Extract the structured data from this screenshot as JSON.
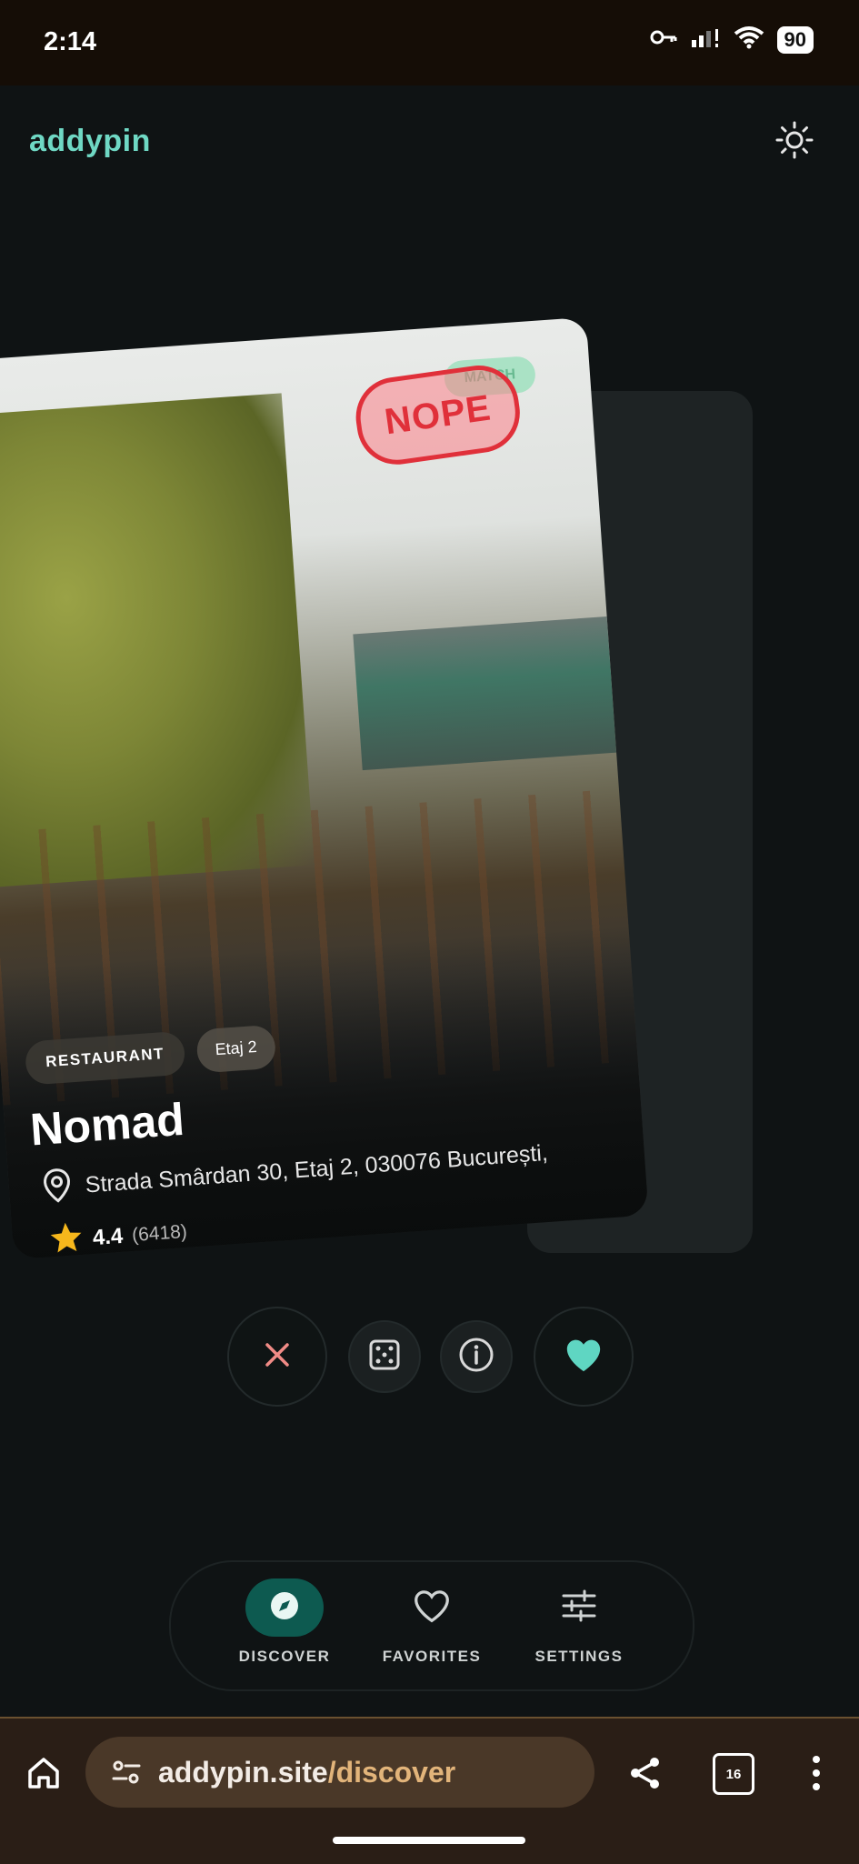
{
  "status_bar": {
    "time": "2:14",
    "battery": "90",
    "icons": [
      "key-icon",
      "signal-icon",
      "wifi-icon",
      "battery-icon"
    ]
  },
  "header": {
    "logo": "addypin",
    "theme_icon": "sun-icon"
  },
  "card": {
    "stamp_nope": "NOPE",
    "stamp_like": "MATCH",
    "tag_type": "RESTAURANT",
    "tag_floor": "Etaj 2",
    "name": "Nomad",
    "address": "Strada Smârdan 30, Etaj 2, 030076 București,",
    "rating": "4.4",
    "reviews": "(6418)"
  },
  "actions": {
    "nope_icon": "close-icon",
    "random_icon": "dice-icon",
    "info_icon": "info-icon",
    "like_icon": "heart-icon"
  },
  "nav": {
    "items": [
      {
        "label": "DISCOVER",
        "icon": "compass-icon",
        "active": true
      },
      {
        "label": "FAVORITES",
        "icon": "heart-outline-icon",
        "active": false
      },
      {
        "label": "SETTINGS",
        "icon": "sliders-icon",
        "active": false
      }
    ]
  },
  "browser": {
    "url_host": "addypin.site",
    "url_path": "/discover",
    "tab_count": "16"
  },
  "colors": {
    "brand": "#6fd8c4",
    "nope_red": "#e0303a",
    "like_teal": "#5fd6c2",
    "background": "#0f1314"
  }
}
